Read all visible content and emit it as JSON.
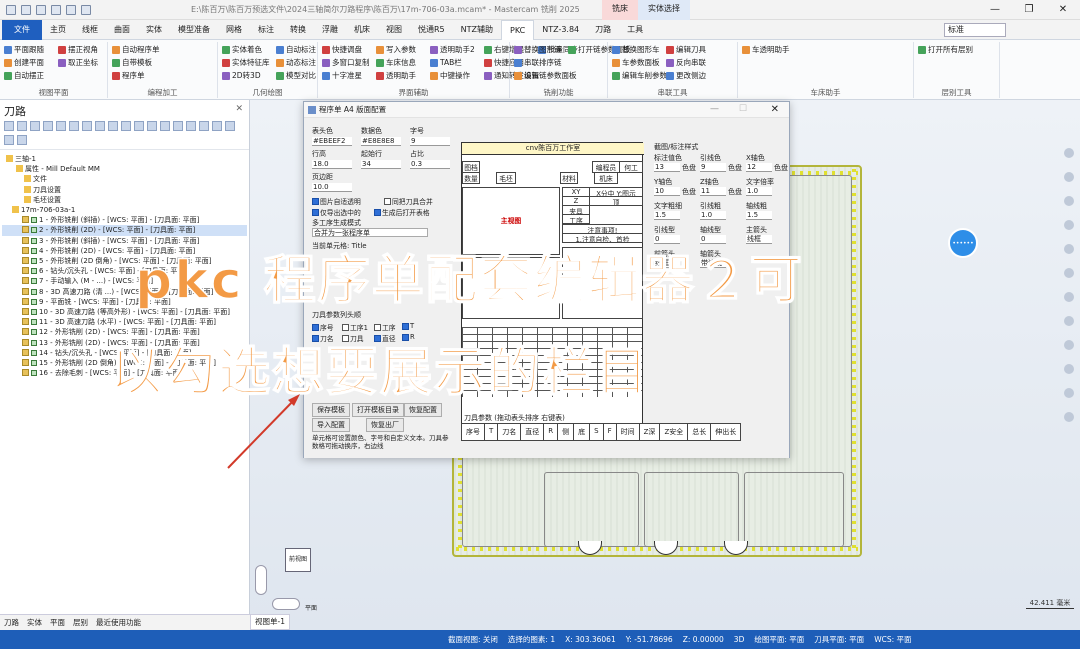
{
  "app": {
    "title": "E:\\陈百万\\陈百万预选文件\\2024三轴简尔刀路程序\\陈百万\\17m-706-03a.mcam* - Mastercam 铣削 2025",
    "context_tabs": [
      "铣床",
      "实体选择"
    ],
    "window_controls": [
      "—",
      "❐",
      "✕"
    ],
    "standard_box": "标准"
  },
  "ribbon_tabs": [
    "文件",
    "主页",
    "线框",
    "曲面",
    "实体",
    "模型准备",
    "网格",
    "标注",
    "转换",
    "浮雕",
    "机床",
    "视图",
    "悦通R5",
    "NTZ辅助",
    "PKC",
    "NTZ-3.84",
    "刀路",
    "工具"
  ],
  "active_tab": "PKC",
  "ribbon_groups": [
    {
      "label": "视图平面",
      "items": [
        "平面跟随",
        "创建平面",
        "自动摆正",
        "摆正视角",
        "取正坐标"
      ]
    },
    {
      "label": "编程加工",
      "items": [
        "自动程序单",
        "自带模板",
        "程序单"
      ]
    },
    {
      "label": "几何绘图",
      "items": [
        "实体着色",
        "实体特征库",
        "2D转3D",
        "自动标注",
        "动态标注",
        "模型对比"
      ]
    },
    {
      "label": "界面辅助",
      "items": [
        "快捷调盘",
        "多窗口复制",
        "十字准星",
        "写入参数",
        "车床信息",
        "透明助手",
        "透明助手2",
        "TAB栏",
        "中键操作",
        "右键增强",
        "快捷应用",
        "通知转发设置",
        "批量同步"
      ]
    },
    {
      "label": "铣削功能",
      "items": [
        "替换图形链",
        "串联排序链",
        "编辑链参数面板",
        "打开链参数面板"
      ]
    },
    {
      "label": "串联工具",
      "items": [
        "替换图形车",
        "车参数面板",
        "编辑车削参数",
        "编辑刀具",
        "反向串联",
        "更改侧边"
      ]
    },
    {
      "label": "车床助手",
      "items": [
        "车透明助手"
      ]
    },
    {
      "label": "层别工具",
      "items": [
        "打开所有层别"
      ]
    }
  ],
  "left_panel": {
    "title": "刀路",
    "tree": [
      "三轴-1",
      "属性 - Mill Default MM",
      "文件",
      "刀具设置",
      "毛坯设置",
      "17m-706-03a-1",
      "1 - 外形铣削 (斜插) - [WCS: 平面] - [刀具面: 平面]",
      "2 - 外形铣削 (2D) - [WCS: 平面] - [刀具面: 平面]",
      "3 - 外形铣削 (斜插) - [WCS: 平面] - [刀具面: 平面]",
      "4 - 外形铣削 (2D) - [WCS: 平面] - [刀具面: 平面]",
      "5 - 外形铣削 (2D 倒角) - [WCS: 平面] - [刀具面: 平面]",
      "6 - 钻头/沉头孔 - [WCS: 平面] - [刀具面: 平面]",
      "7 - 手动输入 (M - ...) - [WCS: 平面]",
      "8 - 3D 高速刀路 (清 ...) - [WCS: 平面] - [刀具面: 平面]",
      "9 - 平面铣 - [WCS: 平面] - [刀具面: 平面]",
      "10 - 3D 高速刀路 (等高外形) - [WCS: 平面] - [刀具面: 平面]",
      "11 - 3D 高速刀路 (水平) - [WCS: 平面] - [刀具面: 平面]",
      "12 - 外形铣削 (2D) - [WCS: 平面] - [刀具面: 平面]",
      "13 - 外形铣削 (2D) - [WCS: 平面] - [刀具面: 平面]",
      "14 - 钻头/沉头孔 - [WCS: 平面] - [刀具面: 平面]",
      "15 - 外形铣削 (2D 倒角) - [WCS: 平面] - [刀具面: 平面]",
      "16 - 去除毛刺 - [WCS: 平面] - [刀具面: 平面]"
    ],
    "bottom_tabs": [
      "刀路",
      "实体",
      "平面",
      "层别",
      "最近使用功能"
    ]
  },
  "viewport": {
    "view_tab": "视图单-1",
    "cube_label": "前视图",
    "plane_label": "平面",
    "scale": "42.411 毫米",
    "circle_label": "••••••"
  },
  "dialog": {
    "title": "程序单 A4 版面配置",
    "fields": {
      "header_color_label": "表头色",
      "header_color": "#EBEEF2",
      "data_color_label": "数据色",
      "data_color": "#E8E8E8",
      "font_size_label": "字号",
      "font_size": "9",
      "row_height_label": "行高",
      "row_height": "18.0",
      "start_row_label": "起始行",
      "start_row": "34",
      "ratio_label": "占比",
      "ratio": "0.3",
      "margin_label": "页边距",
      "margin": "10.0",
      "multi_label": "多工序生成模式",
      "multi_value": "合并为一张程序单",
      "sheet_name_label": "当前单元格: Title"
    },
    "checkboxes_top": [
      {
        "label": "图片自适透明",
        "on": true
      },
      {
        "label": "同把刀具合并",
        "on": false
      },
      {
        "label": "仅导出选中的",
        "on": true
      },
      {
        "label": "生成后打开表格",
        "on": true
      }
    ],
    "tool_section_label": "刀具参数列头顺",
    "checkboxes_tool": [
      {
        "label": "序号",
        "on": true
      },
      {
        "label": "工序1",
        "on": false
      },
      {
        "label": "工序",
        "on": false
      },
      {
        "label": "T",
        "on": true
      },
      {
        "label": "刀名",
        "on": true
      },
      {
        "label": "刀具",
        "on": false
      },
      {
        "label": "直径",
        "on": true
      },
      {
        "label": "R",
        "on": true
      }
    ],
    "buttons": [
      "保存模板",
      "打开模板目录",
      "恢复配置",
      "导入配置",
      "恢复出厂"
    ],
    "note": "单元格可设置颜色、字号和自定义文本。刀具参数格可拖动换序，右边线",
    "sheet": {
      "title": "cnv陈百万工作室",
      "cells": [
        "图档",
        "编程员",
        "何工",
        "数量",
        "毛坯",
        "材料",
        "机床",
        "XY",
        "X分中 Y:图示",
        "Z",
        "顶",
        "夹具",
        "工序",
        "注意事项!",
        "1.注意自检、首检",
        "主视图"
      ],
      "tool_header": [
        "序号",
        "T",
        "刀名",
        "直径",
        "R",
        "侧",
        "底",
        "S",
        "F",
        "时间",
        "Z深",
        "Z安全",
        "总长",
        "伸出长"
      ],
      "tool_row_title": "刀具参数 (拖动表头排序 右键表)"
    },
    "right_col": {
      "title": "截图/标注样式",
      "labels": [
        "标注值色",
        "引线色",
        "X轴色",
        "Y轴色",
        "Z轴色",
        "文字倍率",
        "文字粗细",
        "引线粗",
        "轴线粗",
        "引线型",
        "轴线型",
        "主箭头",
        "前箭头",
        "轴箭头"
      ],
      "values": [
        "13",
        "9",
        "12",
        "10",
        "11",
        "1.0",
        "1.5",
        "1.0",
        "1.5",
        "0",
        "0",
        "线框",
        "线框",
        "带边线"
      ],
      "color_btn": "色盘"
    }
  },
  "overlay": {
    "line1": "pkc 程序单配套编辑器２可",
    "line2": "以勾选想要展示的栏目"
  },
  "statusbar": {
    "items": [
      "截面视图: 关闭",
      "选择的图素: 1",
      "X: 303.36061",
      "Y: -51.78696",
      "Z: 0.00000",
      "3D",
      "绘图平面: 平面",
      "刀具平面: 平面",
      "WCS: 平面"
    ]
  }
}
